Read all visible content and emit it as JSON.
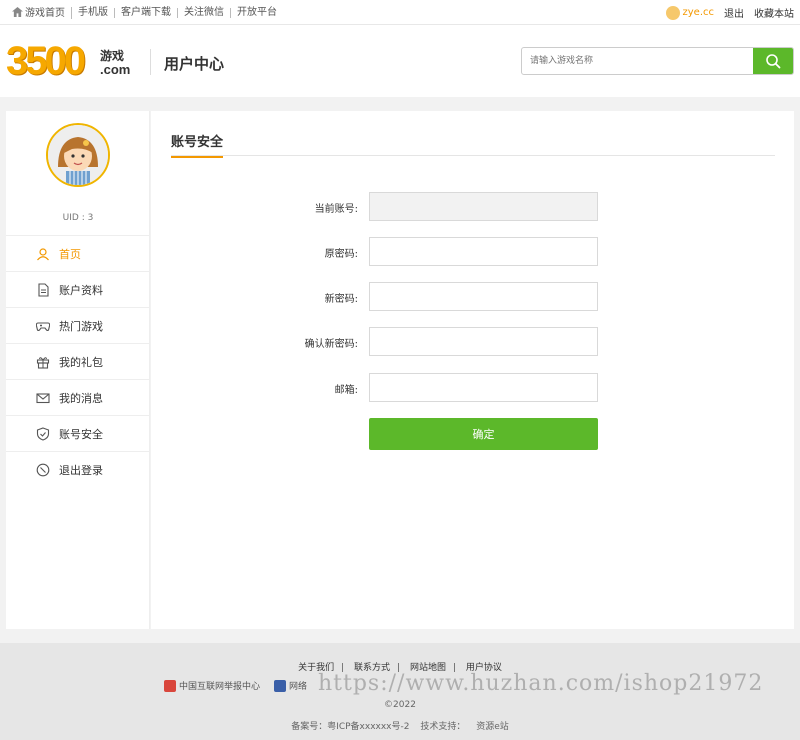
{
  "topbar": {
    "links": [
      "游戏首页",
      "手机版",
      "客户端下载",
      "关注微信",
      "开放平台"
    ],
    "username": "zye.cc",
    "logout": "退出",
    "bookmark": "收藏本站"
  },
  "header": {
    "logo_number": "3500",
    "logo_word": "游戏",
    "logo_domain": ".com",
    "title": "用户中心",
    "search_placeholder": "请输入游戏名称"
  },
  "sidebar": {
    "uid": "UID : 3",
    "items": [
      {
        "label": "首页",
        "icon": "user-icon",
        "active": true
      },
      {
        "label": "账户资料",
        "icon": "document-icon",
        "active": false
      },
      {
        "label": "热门游戏",
        "icon": "gamepad-icon",
        "active": false
      },
      {
        "label": "我的礼包",
        "icon": "gift-icon",
        "active": false
      },
      {
        "label": "我的消息",
        "icon": "mail-icon",
        "active": false
      },
      {
        "label": "账号安全",
        "icon": "shield-icon",
        "active": false
      },
      {
        "label": "退出登录",
        "icon": "logout-icon",
        "active": false
      }
    ]
  },
  "form": {
    "title": "账号安全",
    "fields": [
      {
        "label": "当前账号:",
        "value": "",
        "disabled": true
      },
      {
        "label": "原密码:",
        "value": "",
        "disabled": false
      },
      {
        "label": "新密码:",
        "value": "",
        "disabled": false
      },
      {
        "label": "确认新密码:",
        "value": "",
        "disabled": false
      },
      {
        "label": "邮箱:",
        "value": "",
        "disabled": false
      }
    ],
    "submit_label": "确定"
  },
  "footer": {
    "links": [
      "关于我们",
      "联系方式",
      "网站地图",
      "用户协议"
    ],
    "badge_report": "中国互联网举报中心",
    "badge_network": "网络",
    "copyright": "©2022",
    "icp": "备案号：粤ICP备xxxxxx号-2",
    "support_label": "技术支持：",
    "support_value": "资源e站",
    "watermark": "https://www.huzhan.com/ishop21972"
  },
  "colors": {
    "accent": "#f39800",
    "green": "#5cb82a"
  }
}
